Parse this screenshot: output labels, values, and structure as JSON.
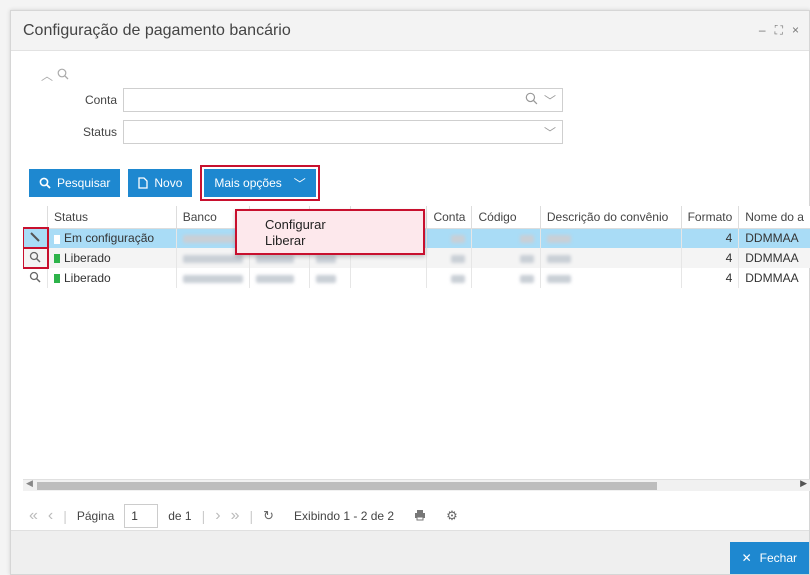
{
  "window": {
    "title": "Configuração de pagamento bancário",
    "controls": {
      "minimize": "–",
      "maximize": "⛶",
      "close": "×"
    }
  },
  "filters": {
    "conta_label": "Conta",
    "status_label": "Status"
  },
  "toolbar": {
    "search_label": "Pesquisar",
    "new_label": "Novo",
    "more_label": "Mais opções"
  },
  "menu": {
    "items": [
      "Configurar",
      "Liberar"
    ]
  },
  "grid": {
    "columns": [
      "Status",
      "Banco",
      "",
      "",
      "",
      "Conta",
      "Código",
      "Descrição do convênio",
      "Formato",
      "Nome do a"
    ],
    "rows": [
      {
        "status": "Em configuração",
        "status_color": "#ffffff",
        "formato": "4",
        "nome": "DDMMAA"
      },
      {
        "status": "Liberado",
        "status_color": "#2db34a",
        "formato": "4",
        "nome": "DDMMAA"
      },
      {
        "status": "Liberado",
        "status_color": "#2db34a",
        "formato": "4",
        "nome": "DDMMAA"
      }
    ]
  },
  "pager": {
    "page_label": "Página",
    "page_value": "1",
    "of_label": "de 1",
    "showing": "Exibindo 1 - 2 de 2"
  },
  "footer": {
    "close_label": "Fechar"
  },
  "colors": {
    "accent": "#1e88d0",
    "highlight": "#c8102e",
    "selected_row": "#a9dcf6"
  }
}
